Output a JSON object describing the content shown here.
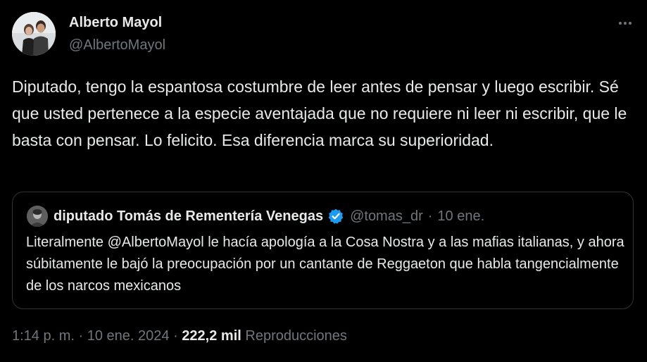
{
  "author": {
    "name": "Alberto Mayol",
    "handle": "@AlbertoMayol"
  },
  "tweet": {
    "text": "Diputado, tengo la espantosa costumbre de leer antes de pensar y luego escribir. Sé que usted pertenece a la especie aventajada que no requiere ni leer ni escribir, que le basta con pensar. Lo felicito. Esa diferencia marca su superioridad."
  },
  "quoted_tweet": {
    "author_name": "diputado Tomás de Rementería Venegas",
    "verified": true,
    "handle": "@tomas_dr",
    "separator": "·",
    "date": "10 ene.",
    "text": "Literalmente @AlbertoMayol le hacía apología a la Cosa Nostra y a las mafias italianas, y ahora súbitamente le bajó la preocupación por un cantante de Reggaeton que habla tangencialmente de los narcos mexicanos"
  },
  "meta": {
    "time": "1:14 p. m.",
    "separator1": "·",
    "date": "10 ene. 2024",
    "separator2": "·",
    "views_count": "222,2 mil",
    "views_label": "Reproducciones"
  },
  "colors": {
    "background": "#000000",
    "text_primary": "#e7e9ea",
    "text_secondary": "#71767b",
    "border": "#2f3336",
    "verified_badge": "#1d9bf0"
  },
  "icons": {
    "more": "more-horizontal-icon",
    "verified": "verified-badge-icon"
  }
}
